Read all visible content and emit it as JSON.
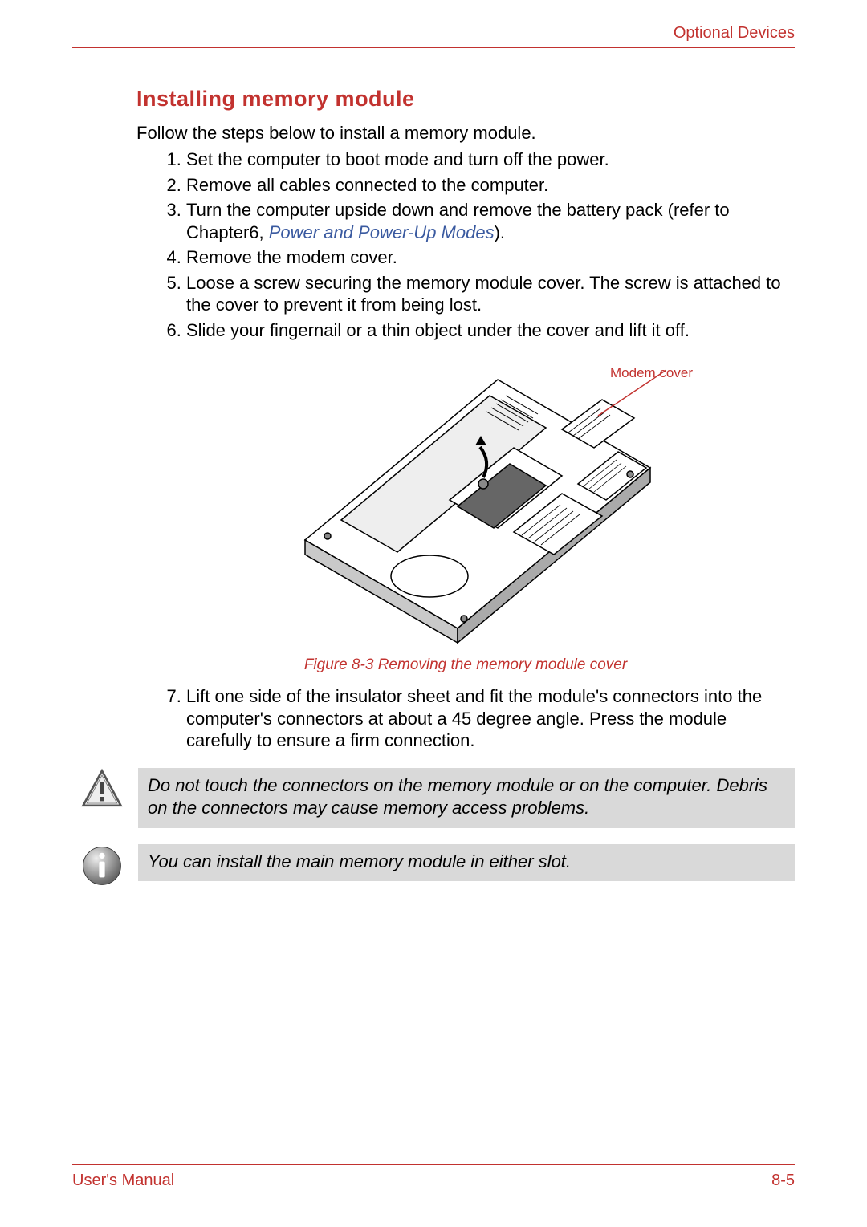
{
  "header": {
    "chapter": "Optional Devices"
  },
  "section": {
    "heading": "Installing memory module"
  },
  "intro": "Follow the steps below to install a memory module.",
  "steps": [
    {
      "text": "Set the computer to boot mode and turn off the power."
    },
    {
      "text_pre": "Remove all cables connected to the computer."
    },
    {
      "text_pre": "Turn the computer upside down and remove the battery pack (refer to Chapter6, ",
      "link": "Power and Power-Up Modes",
      "text_post": ")."
    },
    {
      "text": "Remove the modem cover."
    },
    {
      "text": "Loose a screw securing the memory module cover. The screw is attached to the cover to prevent it from being lost."
    },
    {
      "text": "Slide your fingernail or a thin object under the cover and lift it off."
    }
  ],
  "figure": {
    "callout": "Modem cover",
    "caption": "Figure 8-3 Removing the memory module cover"
  },
  "steps2": [
    {
      "num": "7.",
      "text": "Lift one side of the insulator sheet and fit the module's connectors into the computer's connectors at about a 45 degree angle. Press the module carefully to ensure a firm connection."
    }
  ],
  "caution": "Do not touch the connectors on the memory module or on the computer. Debris on the connectors may cause memory access problems.",
  "info": "You can install the main memory module in either slot.",
  "footer": {
    "left": "User's Manual",
    "right": "8-5"
  }
}
